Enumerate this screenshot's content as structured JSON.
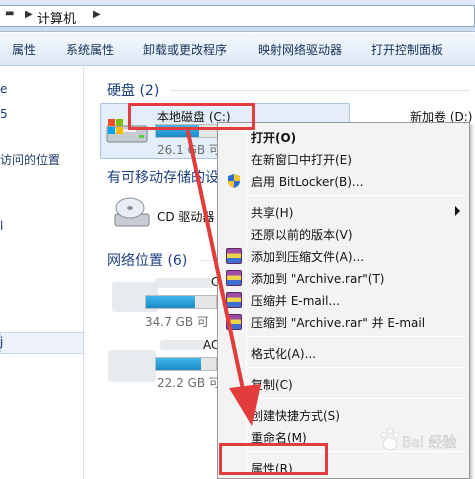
{
  "address_bar": {
    "back_icon": "chevron-right-icon",
    "location": "计算机"
  },
  "toolbar": {
    "buttons": [
      "属性",
      "系统属性",
      "卸载或更改程序",
      "映射网络驱动器",
      "打开控制面板"
    ]
  },
  "nav_pane": {
    "items": [
      "e",
      "5",
      "访问的位置",
      "l",
      "j"
    ]
  },
  "groups": {
    "hard_disks": {
      "header": "硬盘 (2)",
      "drives": [
        {
          "name": "本地磁盘 (C:)",
          "free_text": "26.1 GB 可",
          "fill_fraction": 0.55
        },
        {
          "name": "新加卷 (D:)"
        }
      ]
    },
    "removable": {
      "header": "有可移动存储的设",
      "drives": [
        {
          "name": "CD 驱动器"
        }
      ]
    },
    "network": {
      "header": "网络位置 (6)",
      "drives": [
        {
          "name_fragment": "C",
          "free_text": "34.7 GB 可",
          "fill_fraction": 0.7
        },
        {
          "name_fragment": "AC",
          "free_text": "22.2 GB 可",
          "fill_fraction": 0.75
        }
      ]
    }
  },
  "context_menu": {
    "items": [
      {
        "label": "打开(O)",
        "bold": true
      },
      {
        "label": "在新窗口中打开(E)"
      },
      {
        "label": "启用 BitLocker(B)...",
        "icon": "shield-icon"
      },
      {
        "separator": true
      },
      {
        "label": "共享(H)",
        "submenu": true
      },
      {
        "label": "还原以前的版本(V)"
      },
      {
        "label": "添加到压缩文件(A)...",
        "icon": "winrar-icon"
      },
      {
        "label": "添加到 \"Archive.rar\"(T)",
        "icon": "winrar-icon"
      },
      {
        "label": "压缩并 E-mail...",
        "icon": "winrar-icon"
      },
      {
        "label": "压缩到 \"Archive.rar\" 并 E-mail",
        "icon": "winrar-icon"
      },
      {
        "separator": true
      },
      {
        "label": "格式化(A)..."
      },
      {
        "separator": true
      },
      {
        "label": "复制(C)"
      },
      {
        "separator": true
      },
      {
        "label": "创建快捷方式(S)"
      },
      {
        "label": "重命名(M)"
      },
      {
        "separator": true
      },
      {
        "label": "属性(R)"
      }
    ]
  },
  "annotation": {
    "color": "#e23c3c"
  },
  "watermark": {
    "text": "Bai 经验"
  }
}
